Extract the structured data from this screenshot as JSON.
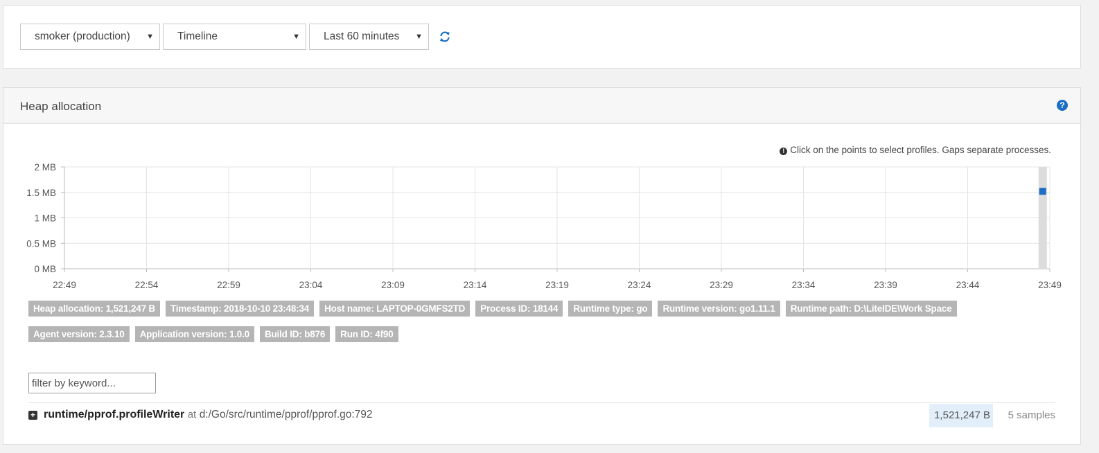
{
  "toolbar": {
    "app_select": "smoker (production)",
    "view_select": "Timeline",
    "range_select": "Last 60 minutes",
    "refresh_icon": "refresh-icon"
  },
  "panel": {
    "title": "Heap allocation",
    "help_icon": "question-icon",
    "hint": "Click on the points to select profiles. Gaps separate processes."
  },
  "chart_data": {
    "type": "scatter",
    "title": "",
    "xlabel": "",
    "ylabel": "",
    "x_ticks": [
      "22:49",
      "22:54",
      "22:59",
      "23:04",
      "23:09",
      "23:14",
      "23:19",
      "23:24",
      "23:29",
      "23:34",
      "23:39",
      "23:44",
      "23:49"
    ],
    "y_ticks": [
      "0 MB",
      "0.5 MB",
      "1 MB",
      "1.5 MB",
      "2 MB"
    ],
    "ylim": [
      0,
      2
    ],
    "xlim": [
      "22:49",
      "23:49"
    ],
    "grid": true,
    "color": "#1d6fc6",
    "highlight_color": "#dcdcdc",
    "series": [
      {
        "points": [
          {
            "x": "23:48:34",
            "y": 1.521247
          }
        ]
      }
    ]
  },
  "tags": [
    "Heap allocation: 1,521,247 B",
    "Timestamp: 2018-10-10 23:48:34",
    "Host name: LAPTOP-0GMFS2TD",
    "Process ID: 18144",
    "Runtime type: go",
    "Runtime version: go1.11.1",
    "Runtime path: D:\\LiteIDE\\Work Space",
    "Agent version: 2.3.10",
    "Application version: 1.0.0",
    "Build ID: b876",
    "Run ID: 4f90"
  ],
  "filter": {
    "placeholder": "filter by keyword..."
  },
  "profile_row": {
    "function": "runtime/pprof.profileWriter",
    "at": "at",
    "location": "d:/Go/src/runtime/pprof/pprof.go:792",
    "bytes": "1,521,247 B",
    "samples": "5 samples"
  }
}
